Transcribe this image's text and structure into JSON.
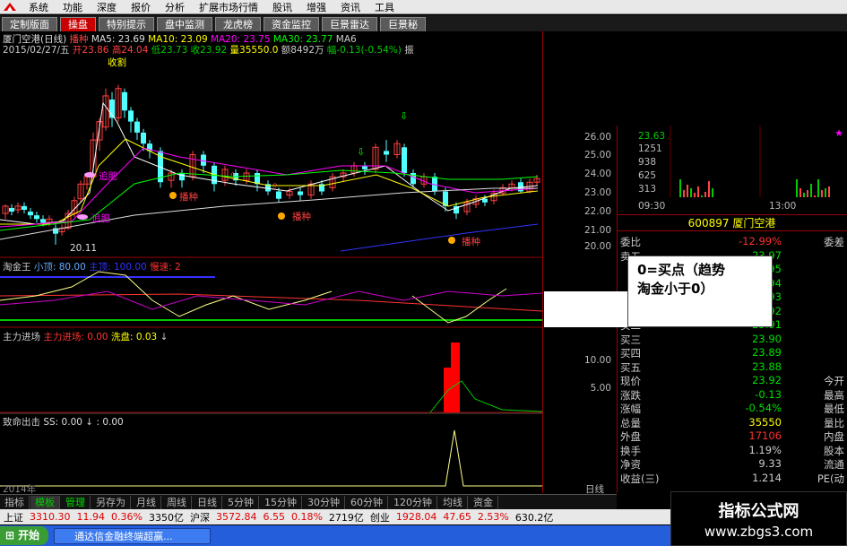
{
  "menu": [
    "系统",
    "功能",
    "深度",
    "报价",
    "分析",
    "扩展市场行情",
    "股讯",
    "增强",
    "资讯",
    "工具"
  ],
  "tabs": [
    {
      "label": "定制版面",
      "active": false
    },
    {
      "label": "操盘",
      "active": true
    },
    {
      "label": "特别提示",
      "active": false
    },
    {
      "label": "盘中监测",
      "active": false
    },
    {
      "label": "龙虎榜",
      "active": false
    },
    {
      "label": "资金监控",
      "active": false
    },
    {
      "label": "巨景雷达",
      "active": false
    },
    {
      "label": "巨景秘",
      "active": false
    }
  ],
  "header": {
    "title": "厦门空港(日线)",
    "marker": "播种",
    "ma5": "MA5: 23.69",
    "ma10": "MA10: 23.09",
    "ma20": "MA20: 23.75",
    "ma30": "MA30: 23.77",
    "ma60": "MA6",
    "date": "2015/02/27/五",
    "open": "开23.86",
    "high": "高24.04",
    "low": "低23.73",
    "close": "收23.92",
    "volume": "量35550.0",
    "amount": "额8492万",
    "change": "幅-0.13(-0.54%)",
    "extra": "振"
  },
  "price_axis": [
    "26.00",
    "25.00",
    "24.00",
    "23.00",
    "22.00",
    "21.00",
    "20.00"
  ],
  "signals": {
    "buy1": "播种",
    "buy2": "播种",
    "buy3": "播种",
    "buy4": "播种",
    "fat1": "追肥",
    "fat2": "追肥",
    "harvest": "收割",
    "low": "20.11"
  },
  "panel1": {
    "name": "淘金王",
    "p1": "小顶: 80.00",
    "p2": "主顶: 100.00",
    "p3": "慢速: 2"
  },
  "panel2": {
    "name": "主力进场",
    "p1": "主力进场: 0.00",
    "p2": "洗盘: 0.03",
    "axis": [
      "10.00",
      "5.00"
    ]
  },
  "panel3": {
    "name": "致命出击",
    "p1": "SS: 0.00",
    "p2": ": 0.00"
  },
  "mini": {
    "labels": [
      "23.63",
      "1251",
      "938",
      "625",
      "313"
    ],
    "time": "09:30",
    "time2": "13:00"
  },
  "stock": {
    "code": "600897",
    "name": "厦门空港"
  },
  "quote": [
    {
      "k": "委比",
      "v": "-12.99%",
      "k2": "委差",
      "c": "#ff3030"
    },
    {
      "k": "卖五",
      "v": "23.97",
      "k2": "",
      "c": "#00e000"
    },
    {
      "k": "",
      "v": "23.95",
      "k2": "",
      "c": "#00e000"
    },
    {
      "k": "",
      "v": "23.94",
      "k2": "",
      "c": "#00e000"
    },
    {
      "k": "",
      "v": "23.93",
      "k2": "",
      "c": "#00e000"
    },
    {
      "k": "",
      "v": "23.92",
      "k2": "",
      "c": "#00e000"
    },
    {
      "k": "买二",
      "v": "23.91",
      "k2": "",
      "c": "#00e000"
    },
    {
      "k": "买三",
      "v": "23.90",
      "k2": "",
      "c": "#00e000"
    },
    {
      "k": "买四",
      "v": "23.89",
      "k2": "",
      "c": "#00e000"
    },
    {
      "k": "买五",
      "v": "23.88",
      "k2": "",
      "c": "#00e000"
    },
    {
      "k": "现价",
      "v": "23.92",
      "k2": "今开",
      "c": "#00e000"
    },
    {
      "k": "涨跌",
      "v": "-0.13",
      "k2": "最高",
      "c": "#00e000"
    },
    {
      "k": "涨幅",
      "v": "-0.54%",
      "k2": "最低",
      "c": "#00e000"
    },
    {
      "k": "总量",
      "v": "35550",
      "k2": "量比",
      "c": "#ffff00"
    },
    {
      "k": "外盘",
      "v": "17106",
      "k2": "内盘",
      "c": "#ff3030"
    },
    {
      "k": "换手",
      "v": "1.19%",
      "k2": "股本",
      "c": "#ccc"
    },
    {
      "k": "净资",
      "v": "9.33",
      "k2": "流通",
      "c": "#ccc"
    },
    {
      "k": "收益(三)",
      "v": "1.214",
      "k2": "PE(动",
      "c": "#ccc"
    }
  ],
  "popup": {
    "line1": "0=买点（趋势",
    "line2": "淘金小于0）"
  },
  "bottom_tabs": [
    {
      "label": "指标",
      "s": ""
    },
    {
      "label": "模板",
      "s": "active"
    },
    {
      "label": "管理",
      "s": "green"
    },
    {
      "label": "另存为",
      "s": ""
    },
    {
      "label": "月线",
      "s": ""
    },
    {
      "label": "周线",
      "s": ""
    },
    {
      "label": "日线",
      "s": ""
    },
    {
      "label": "5分钟",
      "s": ""
    },
    {
      "label": "15分钟",
      "s": ""
    },
    {
      "label": "30分钟",
      "s": ""
    },
    {
      "label": "60分钟",
      "s": ""
    },
    {
      "label": "120分钟",
      "s": ""
    },
    {
      "label": "均线",
      "s": ""
    },
    {
      "label": "资金",
      "s": ""
    }
  ],
  "axis_year": "2014年",
  "bottom_right": "日线",
  "ticker": [
    {
      "t": "上证",
      "c": "#000"
    },
    {
      "t": "3310.30",
      "c": "#d00"
    },
    {
      "t": "11.94",
      "c": "#d00"
    },
    {
      "t": "0.36%",
      "c": "#d00"
    },
    {
      "t": "3350亿",
      "c": "#000"
    },
    {
      "t": "沪深",
      "c": "#000"
    },
    {
      "t": "3572.84",
      "c": "#d00"
    },
    {
      "t": "6.55",
      "c": "#d00"
    },
    {
      "t": "0.18%",
      "c": "#d00"
    },
    {
      "t": "2719亿",
      "c": "#000"
    },
    {
      "t": "创业",
      "c": "#000"
    },
    {
      "t": "1928.04",
      "c": "#d00"
    },
    {
      "t": "47.65",
      "c": "#d00"
    },
    {
      "t": "2.53%",
      "c": "#d00"
    },
    {
      "t": "630.2亿",
      "c": "#000"
    }
  ],
  "taskbar": {
    "start": "开始",
    "item": "通达信金融终端超赢..."
  },
  "watermark": {
    "line1": "指标公式网",
    "line2": "www.zbgs3.com"
  }
}
